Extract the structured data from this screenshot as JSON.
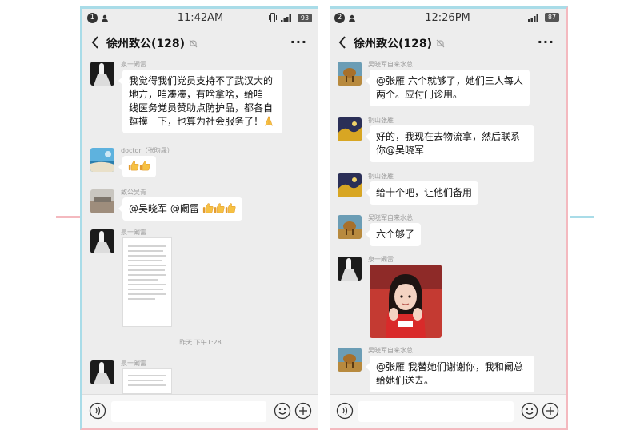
{
  "left_phone": {
    "status": {
      "notification_count": "1",
      "time": "11:42AM",
      "battery": "93"
    },
    "title": "徐州致公(128)",
    "more_label": "···",
    "messages": [
      {
        "name": "泉一阚雷",
        "text": "我觉得我们党员支持不了武汉大的地方，咱凑凑，有啥拿啥，给咱一线医务党员赞助点防护品，都各自踅摸一下，也算为社会服务了！"
      },
      {
        "name": "doctor（张昀晟）"
      },
      {
        "name": "致公吴青",
        "text": "@吴晓军 @阚雷"
      },
      {
        "name": "泉一阚雷"
      },
      {
        "name": "泉一阚雷"
      }
    ],
    "timestamp": "昨天 下午1:28"
  },
  "right_phone": {
    "status": {
      "notification_count": "2",
      "time": "12:26PM",
      "battery": "87"
    },
    "title": "徐州致公(128)",
    "more_label": "···",
    "messages": [
      {
        "name": "吴晓军自来水总",
        "text": "@张雁  六个就够了，她们三人每人两个。应付门诊用。"
      },
      {
        "name": "铜山张雁",
        "text": "好的，我现在去物流拿，然后联系你@吴晓军"
      },
      {
        "name": "铜山张雁",
        "text": "给十个吧，让他们备用"
      },
      {
        "name": "吴晓军自来水总",
        "text": "六个够了"
      },
      {
        "name": "泉一阚雷"
      },
      {
        "name": "吴晓军自来水总",
        "text": "@张雁  我替她们谢谢你，我和阚总给她们送去。"
      }
    ]
  },
  "colors": {
    "chat_background": "#ededed",
    "bubble": "#ffffff",
    "frame_blue": "#a9dce8",
    "frame_pink": "#f4b9bf"
  },
  "icons": [
    "back-arrow-icon",
    "mute-bell-icon",
    "voice-icon",
    "emoji-icon",
    "plus-icon",
    "thumbs-up-icon",
    "folded-hands-icon",
    "signal-icon",
    "vibrate-icon"
  ]
}
